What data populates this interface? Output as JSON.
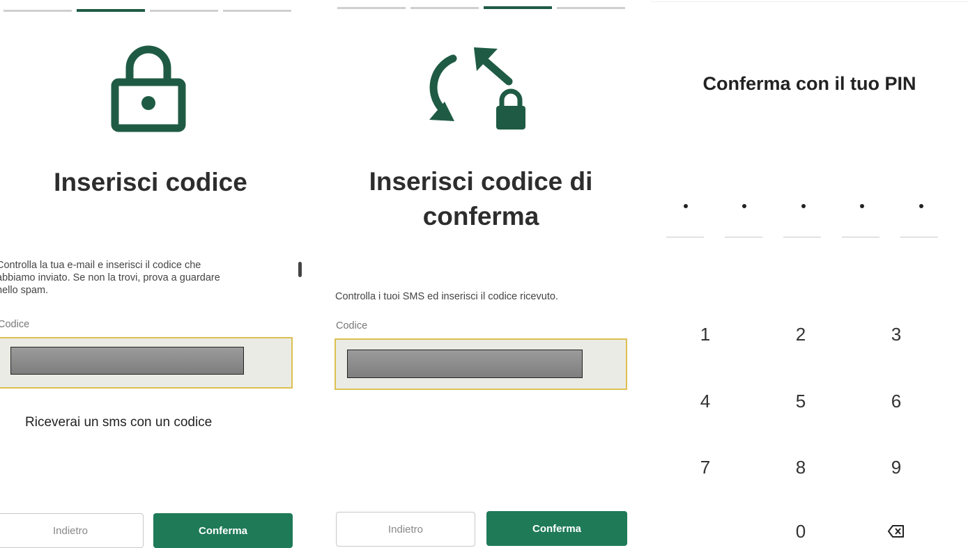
{
  "colors": {
    "brand_green": "#1f5b44",
    "button_green": "#1f7a58",
    "field_border": "#dcc050"
  },
  "email_screen": {
    "progress": {
      "total_steps": 4,
      "current_step": 2
    },
    "icon": "lock-icon",
    "title": "Inserisci codice",
    "description_lines": [
      "Controlla la tua e-mail e inserisci il codice che",
      "abbiamo inviato. Se non la trovi, prova a guardare",
      "nello spam."
    ],
    "field_label": "Codice",
    "note": "Riceverai un sms con un codice",
    "back_label": "Indietro",
    "confirm_label": "Conferma"
  },
  "sms_screen": {
    "progress": {
      "total_steps": 4,
      "current_step": 3
    },
    "icon": "refresh-lock-icon",
    "title_lines": [
      "Inserisci codice di",
      "conferma"
    ],
    "description": "Controlla i tuoi SMS ed inserisci il codice ricevuto.",
    "field_label": "Codice",
    "back_label": "Indietro",
    "confirm_label": "Conferma"
  },
  "pin_screen": {
    "title": "Conferma con il tuo PIN",
    "pin_length": 5,
    "keys": [
      "1",
      "2",
      "3",
      "4",
      "5",
      "6",
      "7",
      "8",
      "9",
      "0"
    ],
    "backspace_icon": "backspace-icon"
  }
}
